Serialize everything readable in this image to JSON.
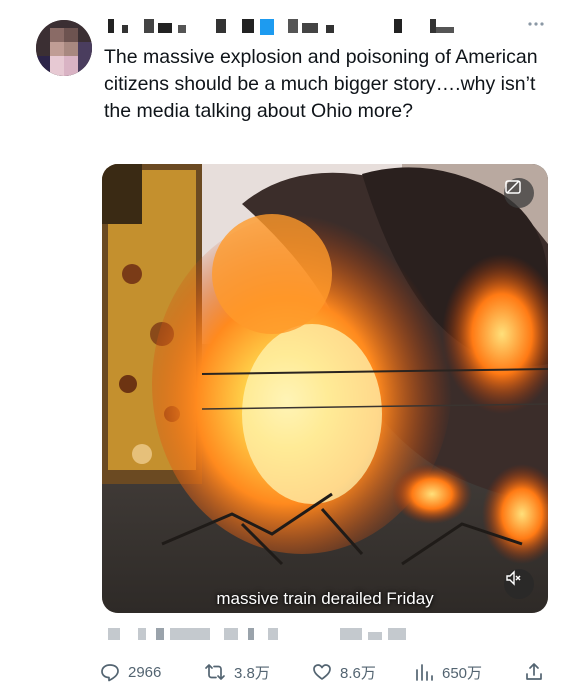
{
  "tweet": {
    "text": "The massive explosion and poisoning of American citizens should be a much bigger story….why isn’t the media talking about Ohio more?",
    "more_icon": "more-horizontal-icon"
  },
  "media": {
    "caption": "massive train derailed Friday",
    "gif_icon": "gif-icon",
    "mute_icon": "speaker-muted-icon"
  },
  "actions": {
    "replies": "2966",
    "retweets": "3.8万",
    "likes": "8.6万",
    "views": "650万"
  },
  "colors": {
    "text": "#0f1419",
    "muted": "#536471",
    "fire_orange": "#ff8a1e",
    "fire_yellow": "#ffd24a"
  }
}
